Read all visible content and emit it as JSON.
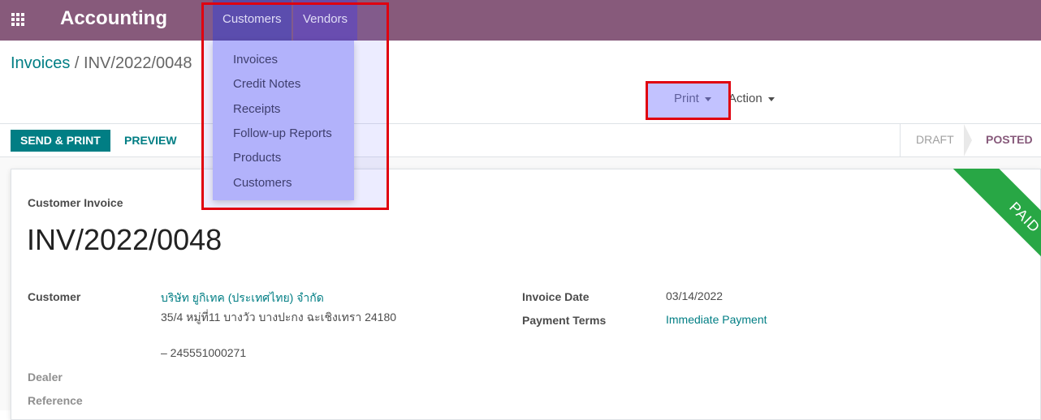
{
  "topbar": {
    "app_title": "Accounting",
    "nav": [
      "Customers",
      "Vendors"
    ]
  },
  "breadcrumb": {
    "parent": "Invoices",
    "separator": " / ",
    "current": "INV/2022/0048"
  },
  "control_panel": {
    "print_label": "Print",
    "action_label": "Action"
  },
  "statusbar": {
    "send_print_label": "SEND & PRINT",
    "preview_label": "PREVIEW",
    "stages": [
      "DRAFT",
      "POSTED"
    ],
    "active_stage": "POSTED"
  },
  "dropdown": {
    "items": [
      "Invoices",
      "Credit Notes",
      "Receipts",
      "Follow-up Reports",
      "Products",
      "Customers"
    ]
  },
  "invoice": {
    "type": "Customer Invoice",
    "number": "INV/2022/0048",
    "ribbon": "PAID",
    "customer_label": "Customer",
    "customer_name": "บริษัท ยูกิเทค (ประเทศไทย) จำกัด",
    "customer_address": "35/4 หมู่ที่11 บางวัว บางปะกง ฉะเชิงเทรา 24180",
    "customer_tax": "– 245551000271",
    "dealer_label": "Dealer",
    "reference_label": "Reference",
    "invoice_date_label": "Invoice Date",
    "invoice_date": "03/14/2022",
    "payment_terms_label": "Payment Terms",
    "payment_terms": "Immediate Payment"
  },
  "colors": {
    "brand": "#875a7b",
    "accent": "#017e84",
    "paid_ribbon": "#28a745",
    "highlight": "#e0000f"
  }
}
